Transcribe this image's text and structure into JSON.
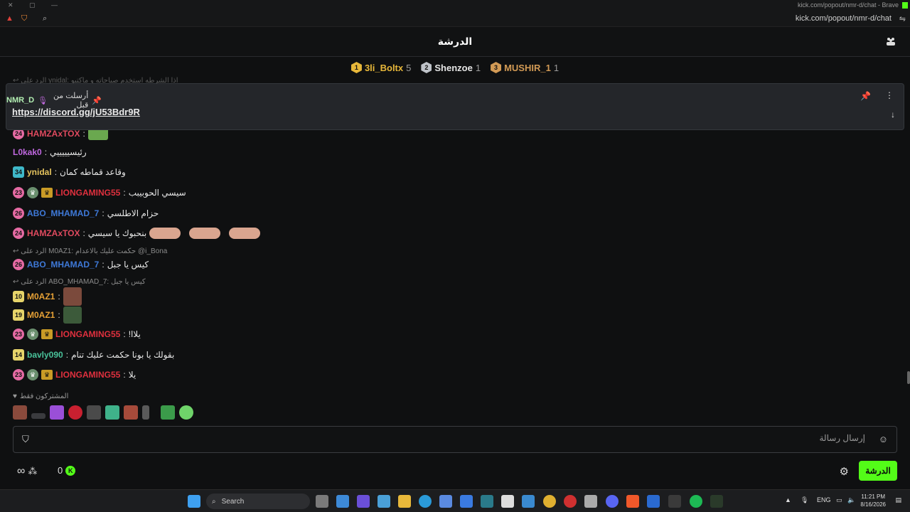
{
  "window": {
    "title": "kick.com/popout/nmr-d/chat - Brave",
    "url": "kick.com/popout/nmr-d/chat"
  },
  "chat": {
    "title": "الدرشة",
    "leaderboard": [
      {
        "rank": "1",
        "name": "3li_Boltx",
        "count": "5",
        "color": "#e7b73a"
      },
      {
        "rank": "2",
        "name": "Shenzoe",
        "count": "1",
        "color": "#bfc3c9"
      },
      {
        "rank": "3",
        "name": "MUSHIR_1",
        "count": "1",
        "color": "#d29a55"
      }
    ],
    "pinned": {
      "label": "أرسلت من قبل",
      "user": "NMR_D",
      "link": "https://discord.gg/jU53Bdr9R"
    },
    "messages": [
      {
        "badge": "24",
        "user": "HAMZAxTOX",
        "text": "",
        "user_color": "#e04a5f",
        "badge_color": "#e56aa3"
      },
      {
        "badge": "",
        "user": "L0kak0",
        "text": "رئيسيييييي",
        "user_color": "#c068e0",
        "badge_color": ""
      },
      {
        "badge": "34",
        "user": "ynidal",
        "text": "وقاعد قماطه كمان",
        "user_color": "#e6c45e",
        "badge_color": "#3fb8c9"
      },
      {
        "badge": "23",
        "user": "LIONGAMING55",
        "text": "سيسي الحوبيبب",
        "user_color": "#e0303e",
        "badge_color": "#e56aa3"
      },
      {
        "badge": "26",
        "user": "ABO_MHAMAD_7",
        "text": "حزام الاطلسي",
        "user_color": "#3e79d8",
        "badge_color": "#e56aa3"
      },
      {
        "badge": "24",
        "user": "HAMZAxTOX",
        "text": "بنحبوك يا سيسي",
        "user_color": "#e04a5f",
        "badge_color": "#e56aa3"
      },
      {
        "badge": "26",
        "user": "ABO_MHAMAD_7",
        "text": "كيس يا جبل",
        "user_color": "#3e79d8",
        "badge_color": "#e56aa3"
      },
      {
        "badge": "10",
        "user": "M0AZ1",
        "text": "",
        "user_color": "#e6a136",
        "badge_color": "#e6d46a"
      },
      {
        "badge": "19",
        "user": "M0AZ1",
        "text": "",
        "user_color": "#e6a136",
        "badge_color": "#e6d46a"
      },
      {
        "badge": "23",
        "user": "LIONGAMING55",
        "text": "يلاا!",
        "user_color": "#e0303e",
        "badge_color": "#e56aa3"
      },
      {
        "badge": "14",
        "user": "bavly090",
        "text": "بقولك يا بونا حكمت عليك تنام",
        "user_color": "#49c29a",
        "badge_color": "#e6d46a"
      },
      {
        "badge": "23",
        "user": "LIONGAMING55",
        "text": "يلا",
        "user_color": "#e0303e",
        "badge_color": "#e56aa3"
      }
    ],
    "replies": {
      "top": "الرد على ynidal: اذا الشرطه استخدم صباحاته و ماكتبو",
      "r1": "الرد على M0AZ1: حكمت عليك بالاعدام @i_Bona",
      "r2": "الرد على ABO_MHAMAD_7: كيس يا جبل"
    },
    "subscribers_only": "المشتركون فقط",
    "input": {
      "placeholder": "إرسال رسالة"
    },
    "footer": {
      "infinity": "∞",
      "points": "0",
      "send_label": "الدرشة"
    }
  },
  "taskbar": {
    "search_label": "Search",
    "lang": "ENG",
    "time": "11:21 PM",
    "date": "8/16/2026"
  },
  "icons": [
    "close-icon",
    "maximize-icon",
    "minimize-icon",
    "brave-icon",
    "search-icon",
    "users-icon",
    "pin-icon",
    "mic-icon",
    "more-icon",
    "scroll-down-icon",
    "reply-icon",
    "heart-icon",
    "shield-icon",
    "emoji-icon",
    "settings-icon",
    "windows-icon"
  ]
}
